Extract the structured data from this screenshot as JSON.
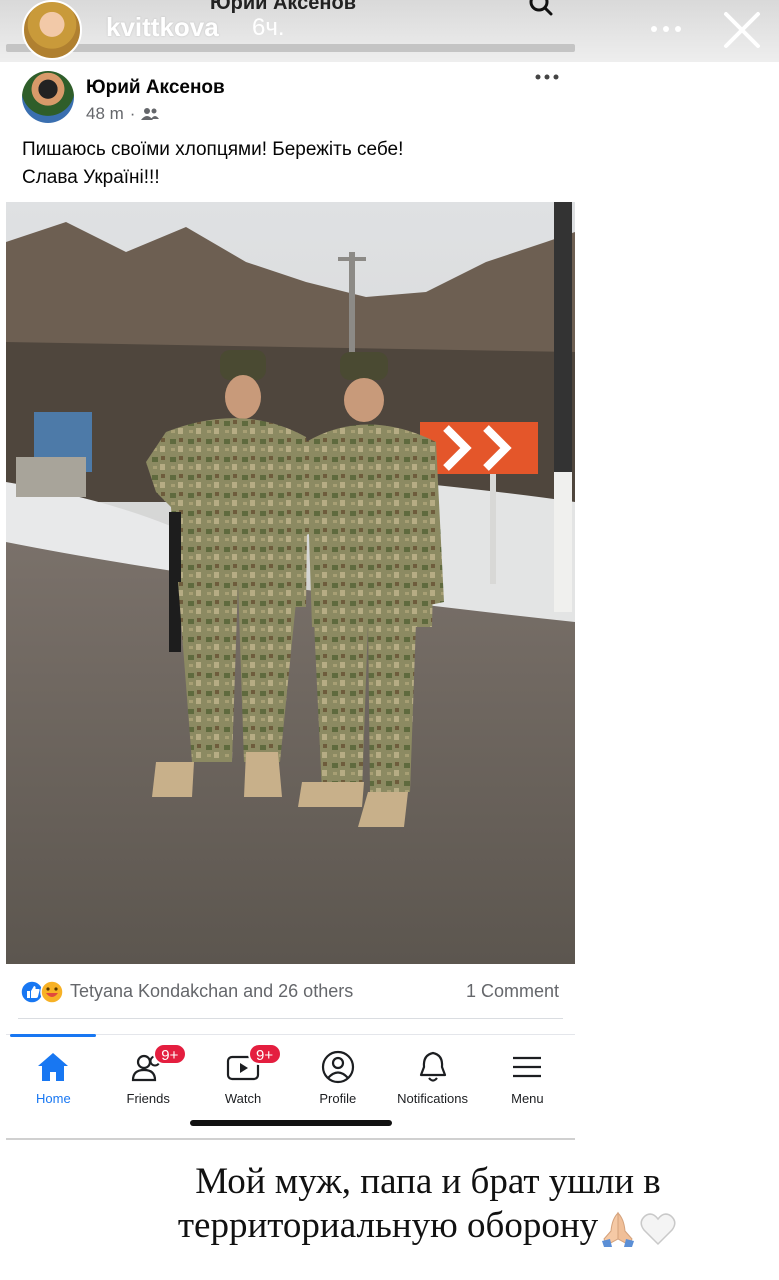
{
  "story": {
    "peek_title": "Юрий Аксенов",
    "username": "kvittkova",
    "time": "6ч.",
    "more_icon": "ellipsis-icon",
    "close_icon": "close-icon",
    "caption_line1": "Мой муж, папа и брат ушли в",
    "caption_line2": "территориальную оборону"
  },
  "post": {
    "author": "Юрий Аксенов",
    "time": "48 m",
    "meta_separator": "·",
    "audience_icon": "friends-icon",
    "text_line1": "Пишаюсь своїми хлопцями! Бережіть себе!",
    "text_line2": "Слава Україні!!!",
    "reactions_text": "Tetyana  Kondakchan and 26 others",
    "comments_text": "1 Comment"
  },
  "tabs": [
    {
      "label": "Home",
      "icon": "home-icon",
      "badge": ""
    },
    {
      "label": "Friends",
      "icon": "friends-icon",
      "badge": "9+"
    },
    {
      "label": "Watch",
      "icon": "watch-icon",
      "badge": "9+"
    },
    {
      "label": "Profile",
      "icon": "profile-icon",
      "badge": ""
    },
    {
      "label": "Notifications",
      "icon": "bell-icon",
      "badge": ""
    },
    {
      "label": "Menu",
      "icon": "menu-icon",
      "badge": ""
    }
  ],
  "colors": {
    "facebook_blue": "#1877f2",
    "badge_red": "#e41e3f",
    "secondary_text": "#65676b"
  }
}
